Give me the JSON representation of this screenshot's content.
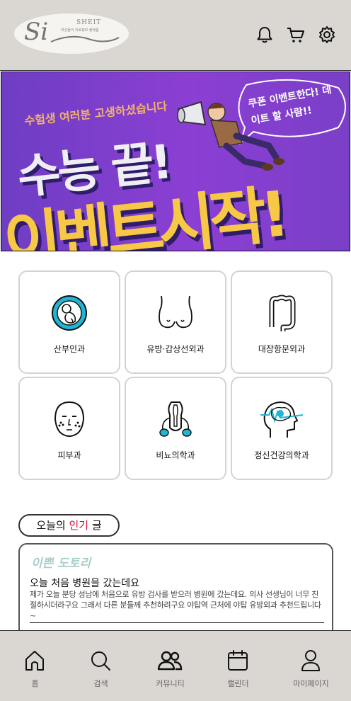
{
  "header": {
    "logo_mark": "Si",
    "logo_word": "SHEIT",
    "logo_tagline": "여성들의 의료정보 플랫폼"
  },
  "banner": {
    "subtitle": "수험생 여러분 고생하셨습니다",
    "line1": "수능 끝!",
    "line2": "이벤트시작!",
    "bubble": "쿠폰 이벤트한다! 데이트 할 사람!!"
  },
  "departments": [
    {
      "label": "산부인과",
      "icon": "fetus-icon"
    },
    {
      "label": "유방·갑상선외과",
      "icon": "breast-icon"
    },
    {
      "label": "대장항문외과",
      "icon": "colon-icon"
    },
    {
      "label": "피부과",
      "icon": "face-skin-icon"
    },
    {
      "label": "비뇨의학과",
      "icon": "urology-icon"
    },
    {
      "label": "정신건강의학과",
      "icon": "brain-icon"
    }
  ],
  "popular": {
    "title_prefix": "오늘의 ",
    "title_highlight": "인기",
    "title_suffix": " 글",
    "post": {
      "author": "이쁜 도토리",
      "title": "오늘 처음 병원을 갔는데요",
      "body": "제가 오늘 분당 성남에 처음으로 유방 검사를 받으러 병원에 갔는데요. 의사 선생님이 너무 친절하시더라구요 그래서 다른 분들께 추천하려구요 야탑역 근처에 야탑 유방외과 추천드립니다~"
    }
  },
  "nav": [
    {
      "label": "홈",
      "icon": "home-icon"
    },
    {
      "label": "검색",
      "icon": "search-icon"
    },
    {
      "label": "커뮤니티",
      "icon": "community-icon"
    },
    {
      "label": "캘린더",
      "icon": "calendar-icon"
    },
    {
      "label": "마이페이지",
      "icon": "person-icon"
    }
  ],
  "colors": {
    "header_bg": "#dad7d3",
    "highlight": "#d6123c",
    "author": "#a7cfc9",
    "icon_accent": "#1fb6d6"
  }
}
